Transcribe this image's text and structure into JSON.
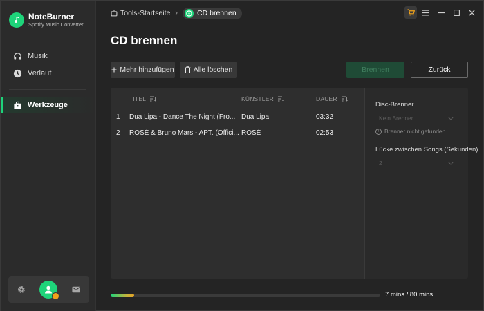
{
  "app": {
    "name": "NoteBurner",
    "subtitle": "Spotify Music Converter",
    "accent_color": "#1ed47a"
  },
  "sidebar": {
    "items": [
      {
        "label": "Musik",
        "icon": "headphones-icon"
      },
      {
        "label": "Verlauf",
        "icon": "clock-icon"
      },
      {
        "label": "Werkzeuge",
        "icon": "toolbox-icon",
        "active": true
      }
    ],
    "bottom": {
      "settings_icon": "gear-icon",
      "avatar_icon": "user-avatar-icon",
      "mail_icon": "mail-icon"
    }
  },
  "breadcrumb": {
    "parent": "Tools-Startseite",
    "current": "CD brennen"
  },
  "page": {
    "title": "CD brennen"
  },
  "toolbar": {
    "add_label": "Mehr hinzufügen",
    "clear_label": "Alle löschen",
    "burn_label": "Brennen",
    "back_label": "Zurück"
  },
  "table": {
    "columns": [
      "TITEL",
      "KÜNSTLER",
      "DAUER"
    ],
    "rows": [
      {
        "index": "1",
        "title": "Dua Lipa - Dance The Night (Fro...",
        "artist": "Dua Lipa",
        "duration": "03:32"
      },
      {
        "index": "2",
        "title": "ROSÉ & Bruno Mars - APT. (Offici...",
        "artist": "ROSÉ",
        "duration": "02:53"
      }
    ]
  },
  "burner_panel": {
    "disc_label": "Disc-Brenner",
    "disc_select": "Kein Brenner",
    "warning": "Brenner nicht gefunden.",
    "gap_label": "Lücke zwischen Songs (Sekunden)",
    "gap_select": "2"
  },
  "progress": {
    "used_fraction": 0.0875,
    "text": "7 mins / 80 mins"
  }
}
